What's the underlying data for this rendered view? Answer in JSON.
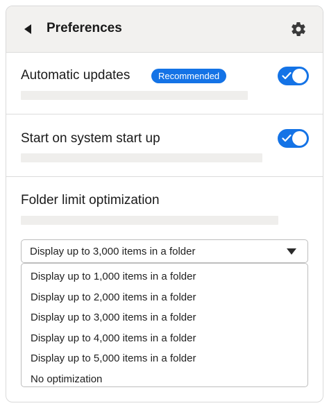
{
  "header": {
    "title": "Preferences",
    "back_icon": "back-triangle-icon",
    "settings_icon": "gear-icon"
  },
  "sections": {
    "automatic_updates": {
      "title": "Automatic updates",
      "badge": "Recommended",
      "toggle_on": true
    },
    "startup": {
      "title": "Start on system start up",
      "toggle_on": true
    },
    "folder_limit": {
      "title": "Folder limit optimization",
      "selected": "Display up to 3,000 items in a folder",
      "options": [
        "Display up to 1,000 items in a folder",
        "Display up to 2,000 items in a folder",
        "Display up to 3,000 items in a folder",
        "Display up to 4,000 items in a folder",
        "Display up to 5,000 items in a folder",
        "No optimization"
      ]
    }
  },
  "colors": {
    "accent": "#1473e6",
    "header_bg": "#f2f1ef",
    "placeholder": "#efeeec"
  }
}
